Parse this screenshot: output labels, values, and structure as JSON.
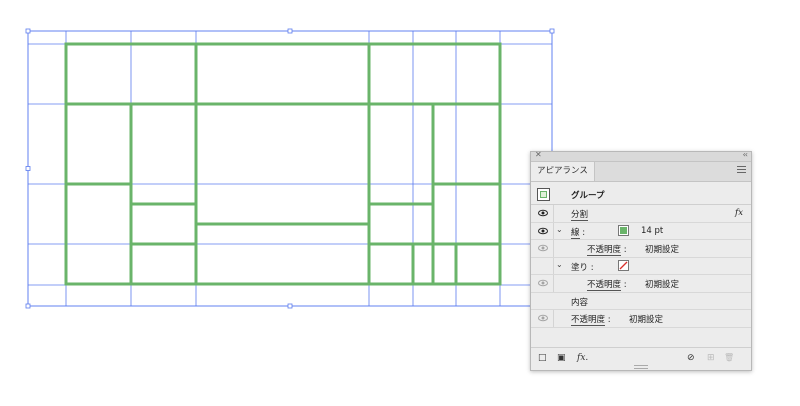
{
  "colors": {
    "guide": "#5b7bef",
    "stroke": "#6ab46a",
    "anchor": "#5b7bef"
  },
  "panel": {
    "close_icon": "close-icon",
    "collapse_icon": "double-chevron-icon",
    "tab_label": "アピアランス",
    "group_label": "グループ",
    "rows": [
      {
        "label": "分割",
        "fx": "fx"
      },
      {
        "label": "線",
        "colon": ":",
        "value": "14 pt"
      },
      {
        "label": "不透明度",
        "colon": ":",
        "value": "初期設定"
      },
      {
        "label": "塗り",
        "colon": ":"
      },
      {
        "label": "不透明度",
        "colon": ":",
        "value": "初期設定"
      },
      {
        "label": "内容"
      },
      {
        "label": "不透明度",
        "colon": ":",
        "value": "初期設定"
      }
    ],
    "bottom": {
      "add_stroke": "□",
      "add_fill": "▣",
      "fx_label": "fx.",
      "clear": "⊘",
      "duplicate": "⊞",
      "delete": "🗑"
    }
  }
}
